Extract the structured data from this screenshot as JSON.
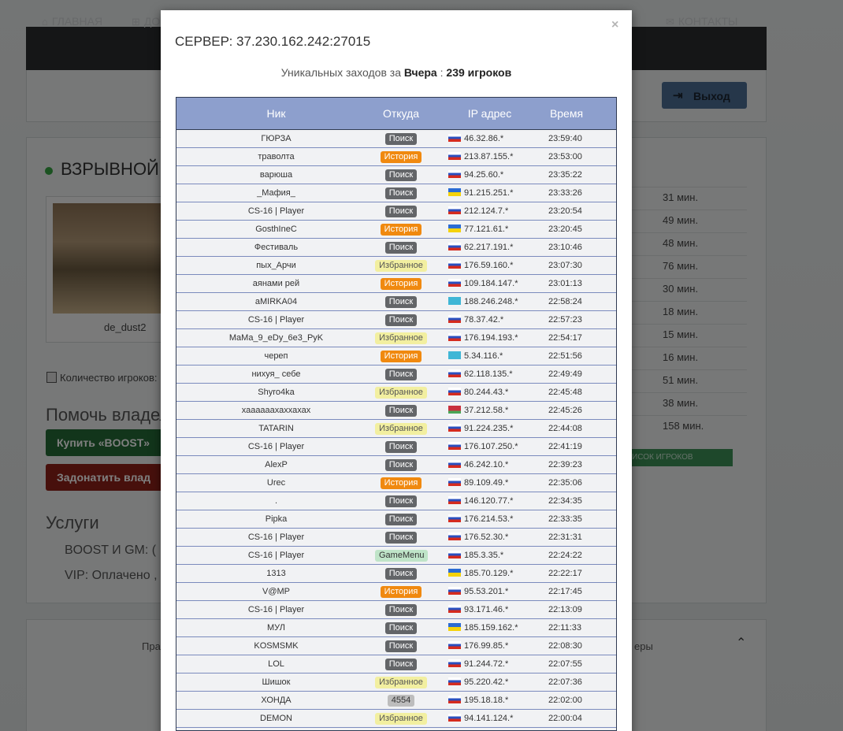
{
  "nav": {
    "items": [
      {
        "label": "ГЛАВНАЯ",
        "icon": "home-icon"
      },
      {
        "label": "ДО",
        "icon": "plus-square-icon"
      },
      {
        "label": "КОНТАКТЫ",
        "icon": "envelope-icon"
      }
    ]
  },
  "header": {
    "exit_label": "Выход"
  },
  "server": {
    "name": "ВЗРЫВНОЙ D",
    "map_name": "de_dust2",
    "players_label": "Количество игроков:",
    "help_title": "Помочь владел",
    "boost_label": "Купить «BOOST»",
    "donate_label": "Задонатить влад",
    "services_title": "Услуги",
    "services": [
      "BOOST И GM:   (",
      "VIP:   Оплачено ,"
    ],
    "times": [
      "31 мин.",
      "49 мин.",
      "48 мин.",
      "76 мин.",
      "30 мин.",
      "18 мин.",
      "15 мин.",
      "16 мин.",
      "51 мин.",
      "38 мин.",
      "158 мин."
    ],
    "players_list_label": "ИСОК ИГРОКОВ"
  },
  "footer": {
    "left_text": "Пра",
    "right_text": "еры"
  },
  "modal": {
    "close": "×",
    "title": "СЕРВЕР: 37.230.162.242:27015",
    "subtitle_prefix": "Уникальных заходов за",
    "subtitle_day": "Вчера",
    "subtitle_sep": ":",
    "subtitle_count": "239 игроков",
    "columns": {
      "nick": "Ник",
      "from": "Откуда",
      "ip": "IP адрес",
      "time": "Время"
    },
    "colors": {
      "header": "#8d9fcd",
      "search": "#636568",
      "history": "#f0890f",
      "favorites": "#f2efa0",
      "gamemenu": "#bfe4c8"
    },
    "rows": [
      {
        "nick": "ГЮРЗА",
        "from": "Поиск",
        "type": "search",
        "flag": "ru",
        "ip": "46.32.86.*",
        "time": "23:59:40"
      },
      {
        "nick": "траволта",
        "from": "История",
        "type": "history",
        "flag": "ru",
        "ip": "213.87.155.*",
        "time": "23:53:00"
      },
      {
        "nick": "варюша",
        "from": "Поиск",
        "type": "search",
        "flag": "ru",
        "ip": "94.25.60.*",
        "time": "23:35:22"
      },
      {
        "nick": "_Мафия_",
        "from": "Поиск",
        "type": "search",
        "flag": "ua",
        "ip": "91.215.251.*",
        "time": "23:33:26"
      },
      {
        "nick": "CS-16 | Player",
        "from": "Поиск",
        "type": "search",
        "flag": "ru",
        "ip": "212.124.7.*",
        "time": "23:20:54"
      },
      {
        "nick": "GosthIneC",
        "from": "История",
        "type": "history",
        "flag": "ua",
        "ip": "77.121.61.*",
        "time": "23:20:45"
      },
      {
        "nick": "Фестиваль",
        "from": "Поиск",
        "type": "search",
        "flag": "ru",
        "ip": "62.217.191.*",
        "time": "23:10:46"
      },
      {
        "nick": "пых_Арчи",
        "from": "Избранное",
        "type": "fav",
        "flag": "ru",
        "ip": "176.59.160.*",
        "time": "23:07:30"
      },
      {
        "nick": "аянами рей",
        "from": "История",
        "type": "history",
        "flag": "ru",
        "ip": "109.184.147.*",
        "time": "23:01:13"
      },
      {
        "nick": "aMIRKA04",
        "from": "Поиск",
        "type": "search",
        "flag": "kz",
        "ip": "188.246.248.*",
        "time": "22:58:24"
      },
      {
        "nick": "CS-16 | Player",
        "from": "Поиск",
        "type": "search",
        "flag": "ru",
        "ip": "78.37.42.*",
        "time": "22:57:23"
      },
      {
        "nick": "MaMa_9_eDy_6e3_PyK",
        "from": "Избранное",
        "type": "fav",
        "flag": "ru",
        "ip": "176.194.193.*",
        "time": "22:54:17"
      },
      {
        "nick": "череп",
        "from": "История",
        "type": "history",
        "flag": "kz",
        "ip": "5.34.116.*",
        "time": "22:51:56"
      },
      {
        "nick": "нихуя_ себе",
        "from": "Поиск",
        "type": "search",
        "flag": "ru",
        "ip": "62.118.135.*",
        "time": "22:49:49"
      },
      {
        "nick": "Shyro4ka",
        "from": "Избранное",
        "type": "fav",
        "flag": "ru",
        "ip": "80.244.43.*",
        "time": "22:45:48"
      },
      {
        "nick": "хаааааахаххахах",
        "from": "Поиск",
        "type": "search",
        "flag": "by",
        "ip": "37.212.58.*",
        "time": "22:45:26"
      },
      {
        "nick": "TATARIN",
        "from": "Избранное",
        "type": "fav",
        "flag": "ru",
        "ip": "91.224.235.*",
        "time": "22:44:08"
      },
      {
        "nick": "CS-16 | Player",
        "from": "Поиск",
        "type": "search",
        "flag": "ru",
        "ip": "176.107.250.*",
        "time": "22:41:19"
      },
      {
        "nick": "AlexP",
        "from": "Поиск",
        "type": "search",
        "flag": "ru",
        "ip": "46.242.10.*",
        "time": "22:39:23"
      },
      {
        "nick": "Urec",
        "from": "История",
        "type": "history",
        "flag": "ru",
        "ip": "89.109.49.*",
        "time": "22:35:06"
      },
      {
        "nick": ".",
        "from": "Поиск",
        "type": "search",
        "flag": "ru",
        "ip": "146.120.77.*",
        "time": "22:34:35"
      },
      {
        "nick": "Pipka",
        "from": "Поиск",
        "type": "search",
        "flag": "ru",
        "ip": "176.214.53.*",
        "time": "22:33:35"
      },
      {
        "nick": "CS-16 | Player",
        "from": "Поиск",
        "type": "search",
        "flag": "ru",
        "ip": "176.52.30.*",
        "time": "22:31:31"
      },
      {
        "nick": "CS-16 | Player",
        "from": "GameMenu",
        "type": "gm",
        "flag": "ru",
        "ip": "185.3.35.*",
        "time": "22:24:22"
      },
      {
        "nick": "1313",
        "from": "Поиск",
        "type": "search",
        "flag": "ua",
        "ip": "185.70.129.*",
        "time": "22:22:17"
      },
      {
        "nick": "V@MP",
        "from": "История",
        "type": "history",
        "flag": "ru",
        "ip": "95.53.201.*",
        "time": "22:17:45"
      },
      {
        "nick": "CS-16 | Player",
        "from": "Поиск",
        "type": "search",
        "flag": "ru",
        "ip": "93.171.46.*",
        "time": "22:13:09"
      },
      {
        "nick": "МУЛ",
        "from": "Поиск",
        "type": "search",
        "flag": "ua",
        "ip": "185.159.162.*",
        "time": "22:11:33"
      },
      {
        "nick": "KOSMSMK",
        "from": "Поиск",
        "type": "search",
        "flag": "ru",
        "ip": "176.99.85.*",
        "time": "22:08:30"
      },
      {
        "nick": "LOL",
        "from": "Поиск",
        "type": "search",
        "flag": "ru",
        "ip": "91.244.72.*",
        "time": "22:07:55"
      },
      {
        "nick": "Шишок",
        "from": "Избранное",
        "type": "fav",
        "flag": "ru",
        "ip": "95.220.42.*",
        "time": "22:07:36"
      },
      {
        "nick": "ХОНДА",
        "from": "4554",
        "type": "code",
        "flag": "ru",
        "ip": "195.18.18.*",
        "time": "22:02:00"
      },
      {
        "nick": "DEMON",
        "from": "Избранное",
        "type": "fav",
        "flag": "ru",
        "ip": "94.141.124.*",
        "time": "22:00:04"
      }
    ]
  }
}
